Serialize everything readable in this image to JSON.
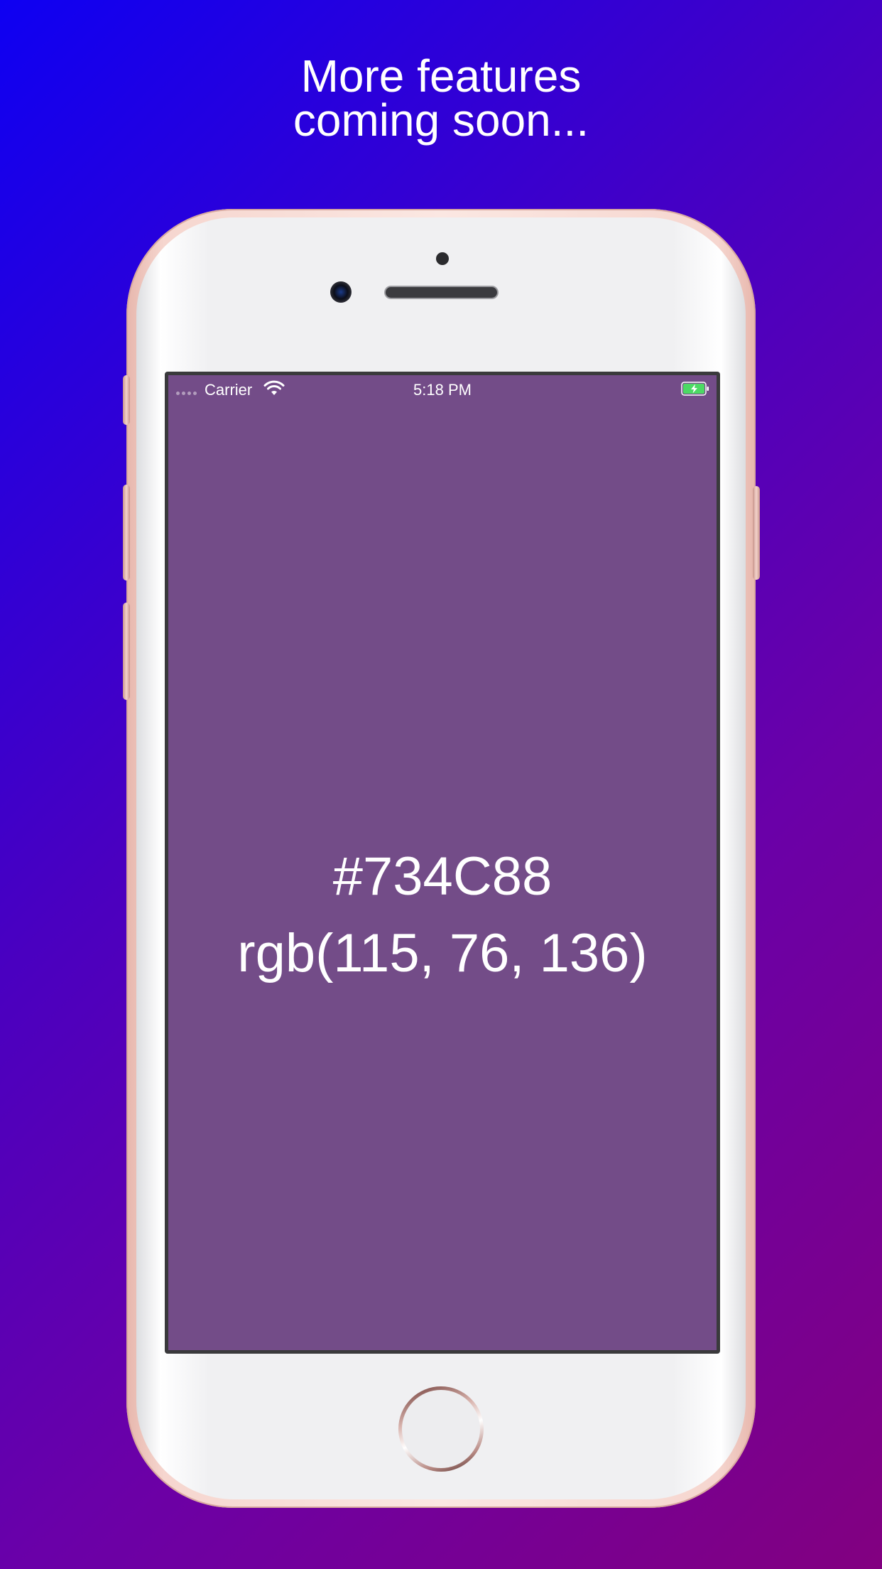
{
  "headline": {
    "line1": "More features",
    "line2": "coming soon..."
  },
  "status_bar": {
    "carrier": "Carrier",
    "time": "5:18 PM",
    "wifi_icon": "wifi-icon",
    "battery_icon": "battery-charging-icon"
  },
  "color_display": {
    "hex": "#734C88",
    "rgb": "rgb(115, 76, 136)"
  },
  "colors": {
    "screen_background": "#734C88",
    "battery_fill": "#4cd964"
  }
}
